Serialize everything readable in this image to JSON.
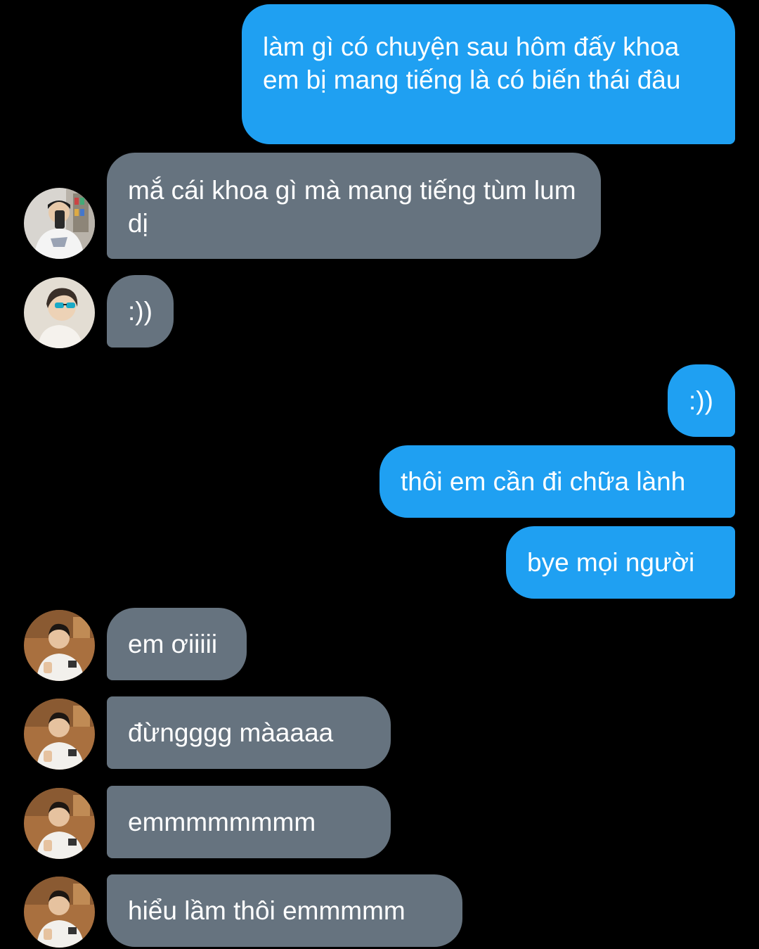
{
  "colors": {
    "background": "#000000",
    "outgoing_bubble": "#1fa0f2",
    "incoming_bubble": "#66737f",
    "text": "#ffffff"
  },
  "messages": [
    {
      "direction": "outgoing",
      "text": "làm gì có chuyện sau hôm đấy khoa em bị mang tiếng là có biến thái đâu"
    },
    {
      "direction": "incoming",
      "avatar": "user-photo-mirror-selfie",
      "text": "mắ cái khoa gì mà mang tiếng tùm lum dị"
    },
    {
      "direction": "incoming",
      "avatar": "user-photo-sunglasses",
      "text": ":))"
    },
    {
      "direction": "outgoing",
      "text": ":))"
    },
    {
      "direction": "outgoing",
      "text": "thôi em cần đi chữa lành"
    },
    {
      "direction": "outgoing",
      "text": "bye mọi người"
    },
    {
      "direction": "incoming",
      "avatar": "user-photo-white-hoodie",
      "text": "em ơiiiii"
    },
    {
      "direction": "incoming",
      "avatar": "user-photo-white-hoodie",
      "text": "đừngggg màaaaa"
    },
    {
      "direction": "incoming",
      "avatar": "user-photo-white-hoodie",
      "text": "emmmmmmmm"
    },
    {
      "direction": "incoming",
      "avatar": "user-photo-white-hoodie",
      "text": "hiểu lầm thôi emmmmm"
    }
  ]
}
